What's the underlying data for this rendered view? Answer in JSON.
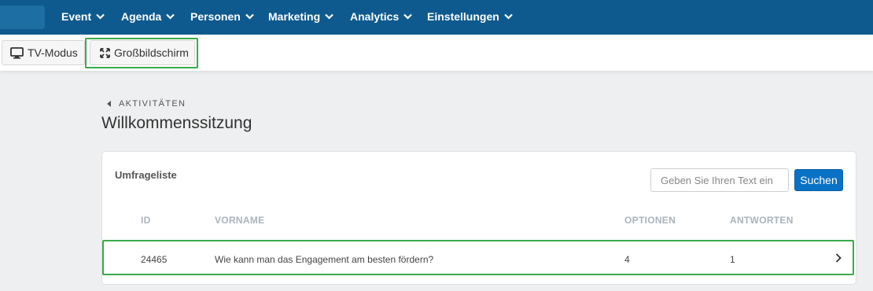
{
  "nav": {
    "items": [
      {
        "label": "Event"
      },
      {
        "label": "Agenda"
      },
      {
        "label": "Personen"
      },
      {
        "label": "Marketing"
      },
      {
        "label": "Analytics"
      },
      {
        "label": "Einstellungen"
      }
    ]
  },
  "toolbar": {
    "tv_mode_label": "TV-Modus",
    "fullscreen_label": "Großbildschirm"
  },
  "breadcrumb": {
    "back_label": "AKTIVITÄTEN"
  },
  "page": {
    "title": "Willkommenssitzung"
  },
  "survey_list": {
    "title": "Umfrageliste",
    "search_placeholder": "Geben Sie Ihren Text ein",
    "search_button": "Suchen",
    "columns": [
      "ID",
      "VORNAME",
      "OPTIONEN",
      "ANTWORTEN"
    ],
    "rows": [
      {
        "id": "24465",
        "name": "Wie kann man das Engagement am besten fördern?",
        "options": "4",
        "answers": "1"
      }
    ]
  },
  "colors": {
    "nav_bg": "#0e5a8f",
    "accent_button": "#0a72c5",
    "highlight": "#3aaa4a"
  }
}
